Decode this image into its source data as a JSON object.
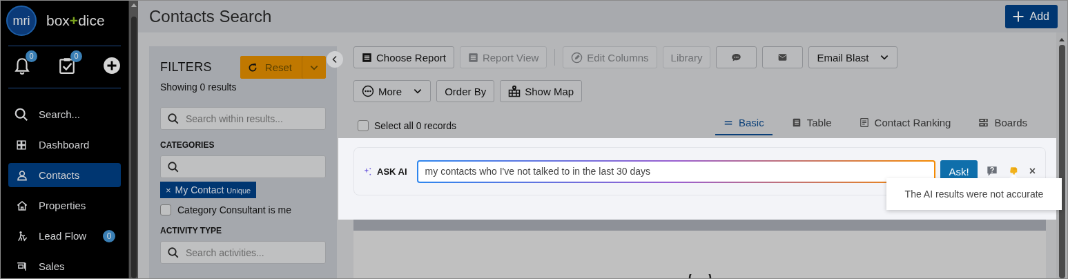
{
  "sidebar": {
    "logo": "mri",
    "brand": [
      "box",
      "+",
      "dice"
    ],
    "quick_actions": [
      {
        "badge": "0"
      },
      {
        "badge": "0"
      }
    ],
    "nav": [
      {
        "label": "Search...",
        "selected": false
      },
      {
        "label": "Dashboard",
        "selected": false
      },
      {
        "label": "Contacts",
        "selected": true
      },
      {
        "label": "Properties",
        "selected": false
      },
      {
        "label": "Lead Flow",
        "selected": false,
        "badge": "0"
      },
      {
        "label": "Sales",
        "selected": false
      }
    ]
  },
  "header": {
    "title": "Contacts Search",
    "add_button": "Add"
  },
  "filters": {
    "title": "FILTERS",
    "reset_button": "Reset",
    "summary": "Showing 0 results",
    "search": {
      "placeholder": "Search within results..."
    },
    "categories": {
      "heading": "CATEGORIES",
      "tags": [
        {
          "remove": "×",
          "label": "My Contact",
          "note": "Unique"
        }
      ],
      "options": [
        {
          "label": "Category Consultant is me",
          "checked": false
        }
      ]
    },
    "activity_type": {
      "heading": "ACTIVITY TYPE",
      "search": {
        "placeholder": "Search activities..."
      }
    }
  },
  "toolbar": {
    "rows": [
      [
        {
          "kind": "button",
          "label": "Choose Report",
          "disabled": false
        },
        {
          "kind": "button",
          "label": "Report View",
          "disabled": true
        },
        {
          "kind": "separator"
        },
        {
          "kind": "button",
          "label": "Edit Columns",
          "disabled": true
        },
        {
          "kind": "button",
          "label": "Library",
          "disabled": true
        },
        {
          "kind": "icon-button",
          "disabled": false
        },
        {
          "kind": "icon-button",
          "disabled": false
        },
        {
          "kind": "dropdown",
          "label": "Email Blast",
          "disabled": false
        }
      ],
      [
        {
          "kind": "dropdown",
          "label": "More",
          "disabled": false
        },
        {
          "kind": "button",
          "label": "Order By",
          "disabled": false
        },
        {
          "kind": "button",
          "label": "Show Map",
          "disabled": false
        }
      ]
    ]
  },
  "select_all": {
    "label": "Select all 0 records",
    "checked": false
  },
  "view_tabs": [
    {
      "label": "Basic",
      "selected": true
    },
    {
      "label": "Table",
      "selected": false
    },
    {
      "label": "Contact Ranking",
      "selected": false
    },
    {
      "label": "Boards",
      "selected": false
    }
  ],
  "ask_ai": {
    "label": "ASK AI",
    "query": "my contacts who I've not talked to in the last 30 days",
    "button": "Ask!",
    "close": "×",
    "tooltip": "The AI results were not accurate"
  }
}
